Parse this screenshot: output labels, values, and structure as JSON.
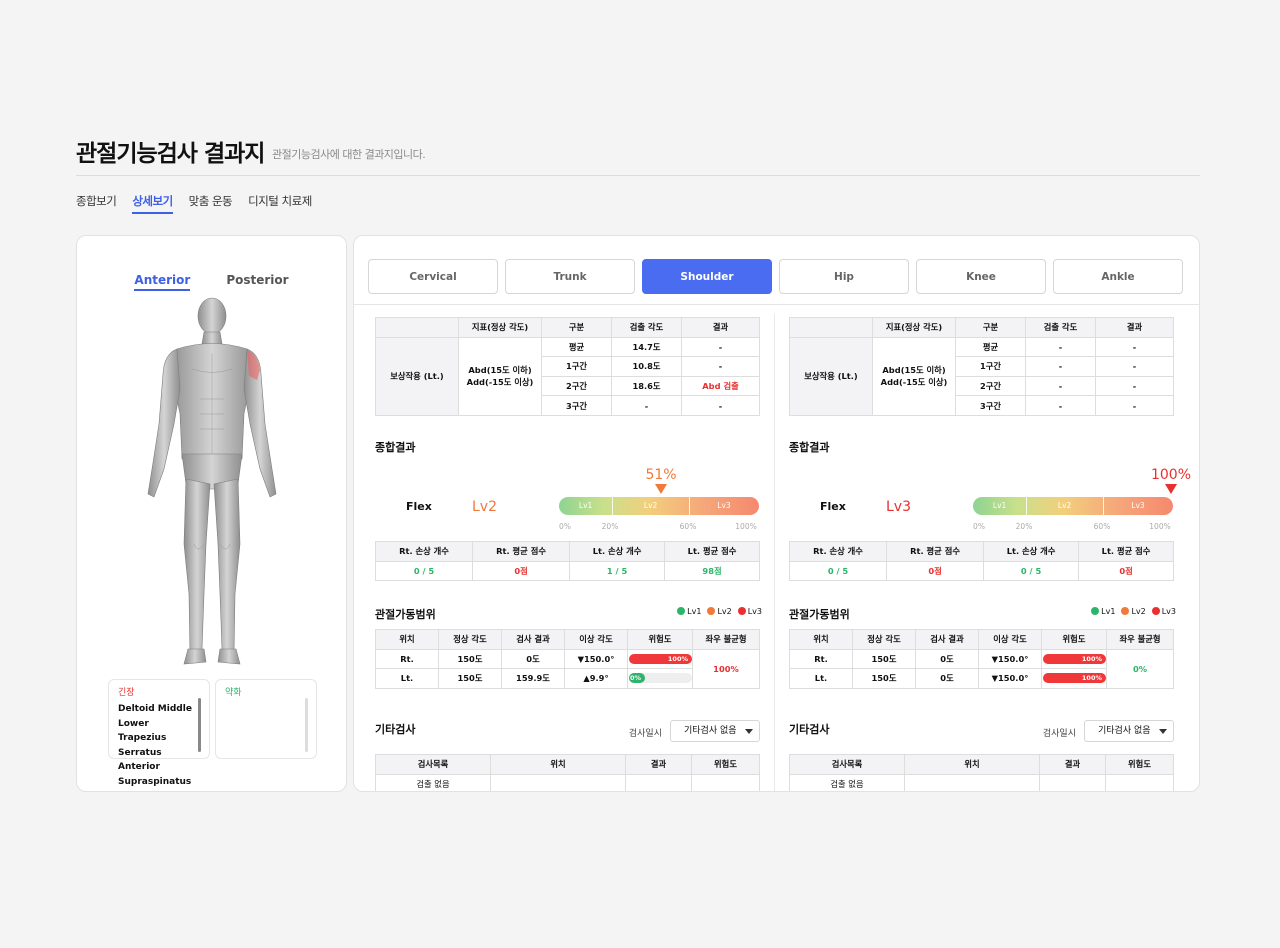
{
  "page": {
    "title": "관절기능검사 결과지",
    "subtitle": "관절기능검사에 대한 결과지입니다."
  },
  "nav": {
    "tabs": [
      {
        "label": "종합보기"
      },
      {
        "label": "상세보기",
        "active": true
      },
      {
        "label": "맞춤 운동"
      },
      {
        "label": "디지털 치료제"
      }
    ]
  },
  "body_view": {
    "anterior": "Anterior",
    "posterior": "Posterior",
    "active": "anterior"
  },
  "tension": {
    "title": "긴장",
    "color": "#e8302f",
    "items": [
      "Deltoid Middle",
      "Lower Trapezius",
      "Serratus Anterior",
      "Supraspinatus"
    ]
  },
  "weakness": {
    "title": "약화",
    "color": "#2eb36a",
    "items": []
  },
  "joint_tabs": [
    "Cervical",
    "Trunk",
    "Shoulder",
    "Hip",
    "Knee",
    "Ankle"
  ],
  "active_joint": "Shoulder",
  "sides": [
    {
      "comp_table": {
        "headers": [
          "지표(정상 각도)",
          "구분",
          "검출 각도",
          "결과"
        ],
        "row_label": "보상작용 (Lt.)",
        "index_lines": [
          "Abd(15도 이하)",
          "Add(-15도 이상)"
        ],
        "rows": [
          {
            "cat": "평균",
            "angle": "14.7도",
            "result": "-"
          },
          {
            "cat": "1구간",
            "angle": "10.8도",
            "result": "-"
          },
          {
            "cat": "2구간",
            "angle": "18.6도",
            "result": "Abd 검출"
          },
          {
            "cat": "3구간",
            "angle": "-",
            "result": "-"
          }
        ]
      },
      "summary_title": "종합결과",
      "flex": {
        "label": "Flex",
        "level": "Lv2",
        "level_color": "#f07a3a",
        "percent_label": "51%",
        "percent_value": 51,
        "marker_color": "#f07a3a",
        "segments": [
          "Lv1",
          "Lv2",
          "Lv3"
        ],
        "ticks": [
          "0%",
          "20%",
          "60%",
          "100%"
        ]
      },
      "score_table": {
        "headers": [
          "Rt. 손상 개수",
          "Rt. 평균 점수",
          "Lt. 손상 개수",
          "Lt. 평균 점수"
        ],
        "values": [
          "0 / 5",
          "0점",
          "1 / 5",
          "98점"
        ],
        "colors": [
          "green",
          "red",
          "green",
          "green"
        ]
      },
      "rom_title": "관절가동범위",
      "legend": [
        {
          "label": "Lv1",
          "color": "#2eb36a"
        },
        {
          "label": "Lv2",
          "color": "#f07a3a"
        },
        {
          "label": "Lv3",
          "color": "#e8302f"
        }
      ],
      "rom_table": {
        "headers": [
          "위치",
          "정상 각도",
          "검사 결과",
          "이상 각도",
          "위험도",
          "좌우 불균형"
        ],
        "rows": [
          {
            "pos": "Rt.",
            "normal": "150도",
            "result": "0도",
            "abnormal": "▼150.0°",
            "risk_label": "100%",
            "risk": 1.0,
            "risk_color": "#f0383a"
          },
          {
            "pos": "Lt.",
            "normal": "150도",
            "result": "159.9도",
            "abnormal": "▲9.9°",
            "risk_label": "0%",
            "risk": 0.0,
            "risk_color": "#2eb36a"
          }
        ],
        "imbalance": "100%",
        "imbalance_color": "red"
      },
      "other_title": "기타검사",
      "date_label": "검사일시",
      "date_value": "기타검사 없음",
      "other_table": {
        "headers": [
          "검사목록",
          "위치",
          "결과",
          "위험도"
        ],
        "rows": [
          [
            "검출 없음",
            "",
            "",
            ""
          ]
        ]
      }
    },
    {
      "comp_table": {
        "headers": [
          "지표(정상 각도)",
          "구분",
          "검출 각도",
          "결과"
        ],
        "row_label": "보상작용 (Lt.)",
        "index_lines": [
          "Abd(15도 이하)",
          "Add(-15도 이상)"
        ],
        "rows": [
          {
            "cat": "평균",
            "angle": "-",
            "result": "-"
          },
          {
            "cat": "1구간",
            "angle": "-",
            "result": "-"
          },
          {
            "cat": "2구간",
            "angle": "-",
            "result": "-"
          },
          {
            "cat": "3구간",
            "angle": "-",
            "result": "-"
          }
        ]
      },
      "summary_title": "종합결과",
      "flex": {
        "label": "Flex",
        "level": "Lv3",
        "level_color": "#e8302f",
        "percent_label": "100%",
        "percent_value": 100,
        "marker_color": "#e8302f",
        "segments": [
          "Lv1",
          "Lv2",
          "Lv3"
        ],
        "ticks": [
          "0%",
          "20%",
          "60%",
          "100%"
        ]
      },
      "score_table": {
        "headers": [
          "Rt. 손상 개수",
          "Rt. 평균 점수",
          "Lt. 손상 개수",
          "Lt. 평균 점수"
        ],
        "values": [
          "0 / 5",
          "0점",
          "0 / 5",
          "0점"
        ],
        "colors": [
          "green",
          "red",
          "green",
          "red"
        ]
      },
      "rom_title": "관절가동범위",
      "legend": [
        {
          "label": "Lv1",
          "color": "#2eb36a"
        },
        {
          "label": "Lv2",
          "color": "#f07a3a"
        },
        {
          "label": "Lv3",
          "color": "#e8302f"
        }
      ],
      "rom_table": {
        "headers": [
          "위치",
          "정상 각도",
          "검사 결과",
          "이상 각도",
          "위험도",
          "좌우 불균형"
        ],
        "rows": [
          {
            "pos": "Rt.",
            "normal": "150도",
            "result": "0도",
            "abnormal": "▼150.0°",
            "risk_label": "100%",
            "risk": 1.0,
            "risk_color": "#f0383a"
          },
          {
            "pos": "Lt.",
            "normal": "150도",
            "result": "0도",
            "abnormal": "▼150.0°",
            "risk_label": "100%",
            "risk": 1.0,
            "risk_color": "#f0383a"
          }
        ],
        "imbalance": "0%",
        "imbalance_color": "green"
      },
      "other_title": "기타검사",
      "date_label": "검사일시",
      "date_value": "기타검사 없음",
      "other_table": {
        "headers": [
          "검사목록",
          "위치",
          "결과",
          "위험도"
        ],
        "rows": [
          [
            "검출 없음",
            "",
            "",
            ""
          ]
        ]
      }
    }
  ]
}
